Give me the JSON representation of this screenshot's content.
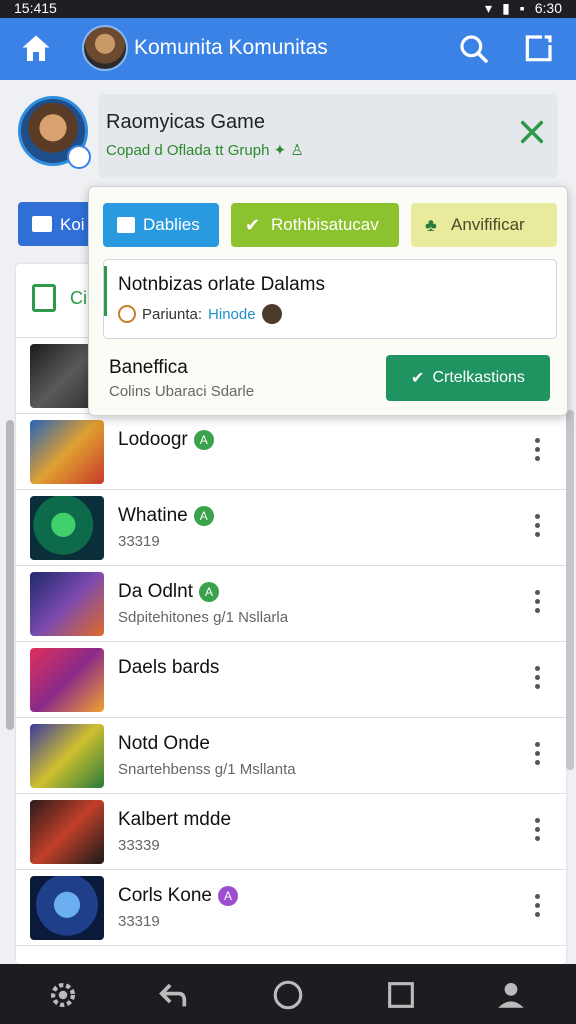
{
  "status": {
    "time": "15:415",
    "clock": "6:30"
  },
  "app_bar": {
    "title": "Komunita Komunitas"
  },
  "profile": {
    "name": "Raomyicas Game",
    "subtitle": "Copad d Oflada tt Gruph",
    "emoji": "✦ ♙"
  },
  "side_button": {
    "label": "Koi"
  },
  "list_header": {
    "label": "Ci"
  },
  "popup": {
    "chips": [
      {
        "label": "Dablies",
        "color": "#2a9ae0"
      },
      {
        "label": "Rothbisatucav",
        "color": "#8cc22e"
      },
      {
        "label": "Anvifificar",
        "color": "#e8ea9c"
      }
    ],
    "card": {
      "title": "Notnbizas orlate Dalams",
      "meta_prefix": "Pariunta:",
      "meta_highlight": "Hinode"
    },
    "footer": {
      "title": "Baneffica",
      "subtitle": "Colins Ubaraci Sdarle"
    },
    "confirm_label": "Crtelkastions"
  },
  "games": [
    {
      "name": "Lodoogr",
      "badge": "A",
      "sub": ""
    },
    {
      "name": "Whatine",
      "badge": "A",
      "sub": "33319"
    },
    {
      "name": "Da Odlnt",
      "badge": "A",
      "sub": "Sdpitehitones g/1 Nsllarla"
    },
    {
      "name": "Daels bards",
      "badge": "",
      "sub": ""
    },
    {
      "name": "Notd Onde",
      "badge": "",
      "sub": "Snartehbenss g/1 Msllanta"
    },
    {
      "name": "Kalbert mdde",
      "badge": "",
      "sub": "33339"
    },
    {
      "name": "Corls Kone",
      "badge": "A",
      "sub": "33319"
    }
  ]
}
